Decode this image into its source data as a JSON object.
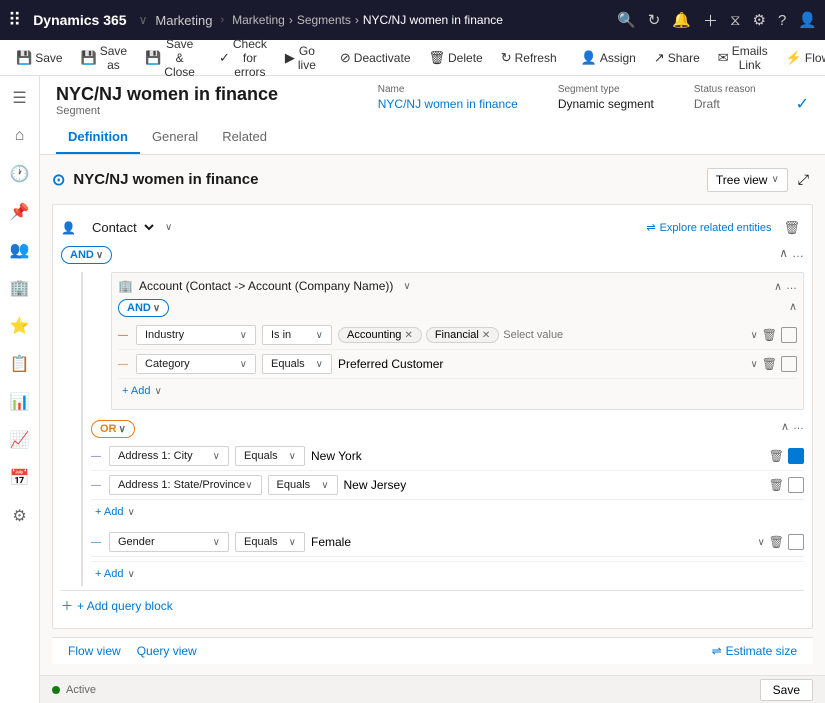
{
  "app": {
    "brand": "Dynamics 365",
    "nav_items": [
      "Marketing"
    ],
    "breadcrumb": [
      "Marketing",
      "Segments",
      "NYC/NJ women in finance"
    ],
    "top_icons": [
      "search",
      "refresh",
      "bell",
      "plus",
      "filter",
      "settings",
      "help",
      "user"
    ]
  },
  "command_bar": {
    "buttons": [
      {
        "id": "save",
        "label": "Save",
        "icon": "💾"
      },
      {
        "id": "save_as",
        "label": "Save as",
        "icon": "💾"
      },
      {
        "id": "save_close",
        "label": "Save & Close",
        "icon": "💾"
      },
      {
        "id": "check_errors",
        "label": "Check for errors",
        "icon": "✓"
      },
      {
        "id": "go_live",
        "label": "Go live",
        "icon": "▶"
      },
      {
        "id": "deactivate",
        "label": "Deactivate",
        "icon": "⊘"
      },
      {
        "id": "delete",
        "label": "Delete",
        "icon": "🗑"
      },
      {
        "id": "refresh",
        "label": "Refresh",
        "icon": "↻"
      },
      {
        "id": "assign",
        "label": "Assign",
        "icon": "👤"
      },
      {
        "id": "share",
        "label": "Share",
        "icon": "↗"
      },
      {
        "id": "emails_link",
        "label": "Emails Link",
        "icon": "✉"
      },
      {
        "id": "flow",
        "label": "Flow",
        "icon": "⚡"
      }
    ]
  },
  "sidebar": {
    "items": [
      {
        "id": "home",
        "icon": "⌂"
      },
      {
        "id": "recent",
        "icon": "🕐"
      },
      {
        "id": "pinned",
        "icon": "📌"
      },
      {
        "id": "contacts",
        "icon": "👥"
      },
      {
        "id": "accounts",
        "icon": "🏢"
      },
      {
        "id": "leads",
        "icon": "⭐"
      },
      {
        "id": "opportunities",
        "icon": "💼"
      },
      {
        "id": "activities",
        "icon": "📋"
      },
      {
        "id": "reports",
        "icon": "📊"
      },
      {
        "id": "dashboards",
        "icon": "📈"
      },
      {
        "id": "calendar",
        "icon": "📅"
      },
      {
        "id": "settings",
        "icon": "⚙"
      }
    ]
  },
  "form": {
    "title": "NYC/NJ women in finance",
    "entity_type": "Segment",
    "fields": {
      "name": {
        "label": "Name",
        "value": "NYC/NJ women in finance"
      },
      "segment_type": {
        "label": "Segment type",
        "value": "Dynamic segment"
      },
      "status_reason": {
        "label": "Status reason",
        "value": "Draft"
      }
    },
    "tabs": [
      {
        "id": "definition",
        "label": "Definition",
        "active": true
      },
      {
        "id": "general",
        "label": "General"
      },
      {
        "id": "related",
        "label": "Related"
      }
    ]
  },
  "builder": {
    "title": "NYC/NJ women in finance",
    "tree_view": "Tree view",
    "explore_related": "Explore related entities",
    "contact_entity": "Contact",
    "and_label": "AND",
    "or_label": "OR",
    "account_relation": "Account (Contact -> Account (Company Name))",
    "conditions": {
      "industry": {
        "field": "Industry",
        "operator": "Is in",
        "values": [
          "Accounting",
          "Financial"
        ],
        "placeholder": "Select value"
      },
      "category": {
        "field": "Category",
        "operator": "Equals",
        "values": [
          "Preferred Customer"
        ]
      },
      "address_city": {
        "field": "Address 1: City",
        "operator": "Equals",
        "values": [
          "New York"
        ]
      },
      "address_state": {
        "field": "Address 1: State/Province",
        "operator": "Equals",
        "values": [
          "New Jersey"
        ]
      },
      "gender": {
        "field": "Gender",
        "operator": "Equals",
        "values": [
          "Female"
        ]
      }
    },
    "add_label": "+ Add",
    "add_query_block": "+ Add query block",
    "bottom_views": {
      "flow_view": "Flow view",
      "query_view": "Query view"
    },
    "estimate_size": "Estimate size"
  },
  "status_bar": {
    "status": "Active",
    "save_label": "Save"
  }
}
